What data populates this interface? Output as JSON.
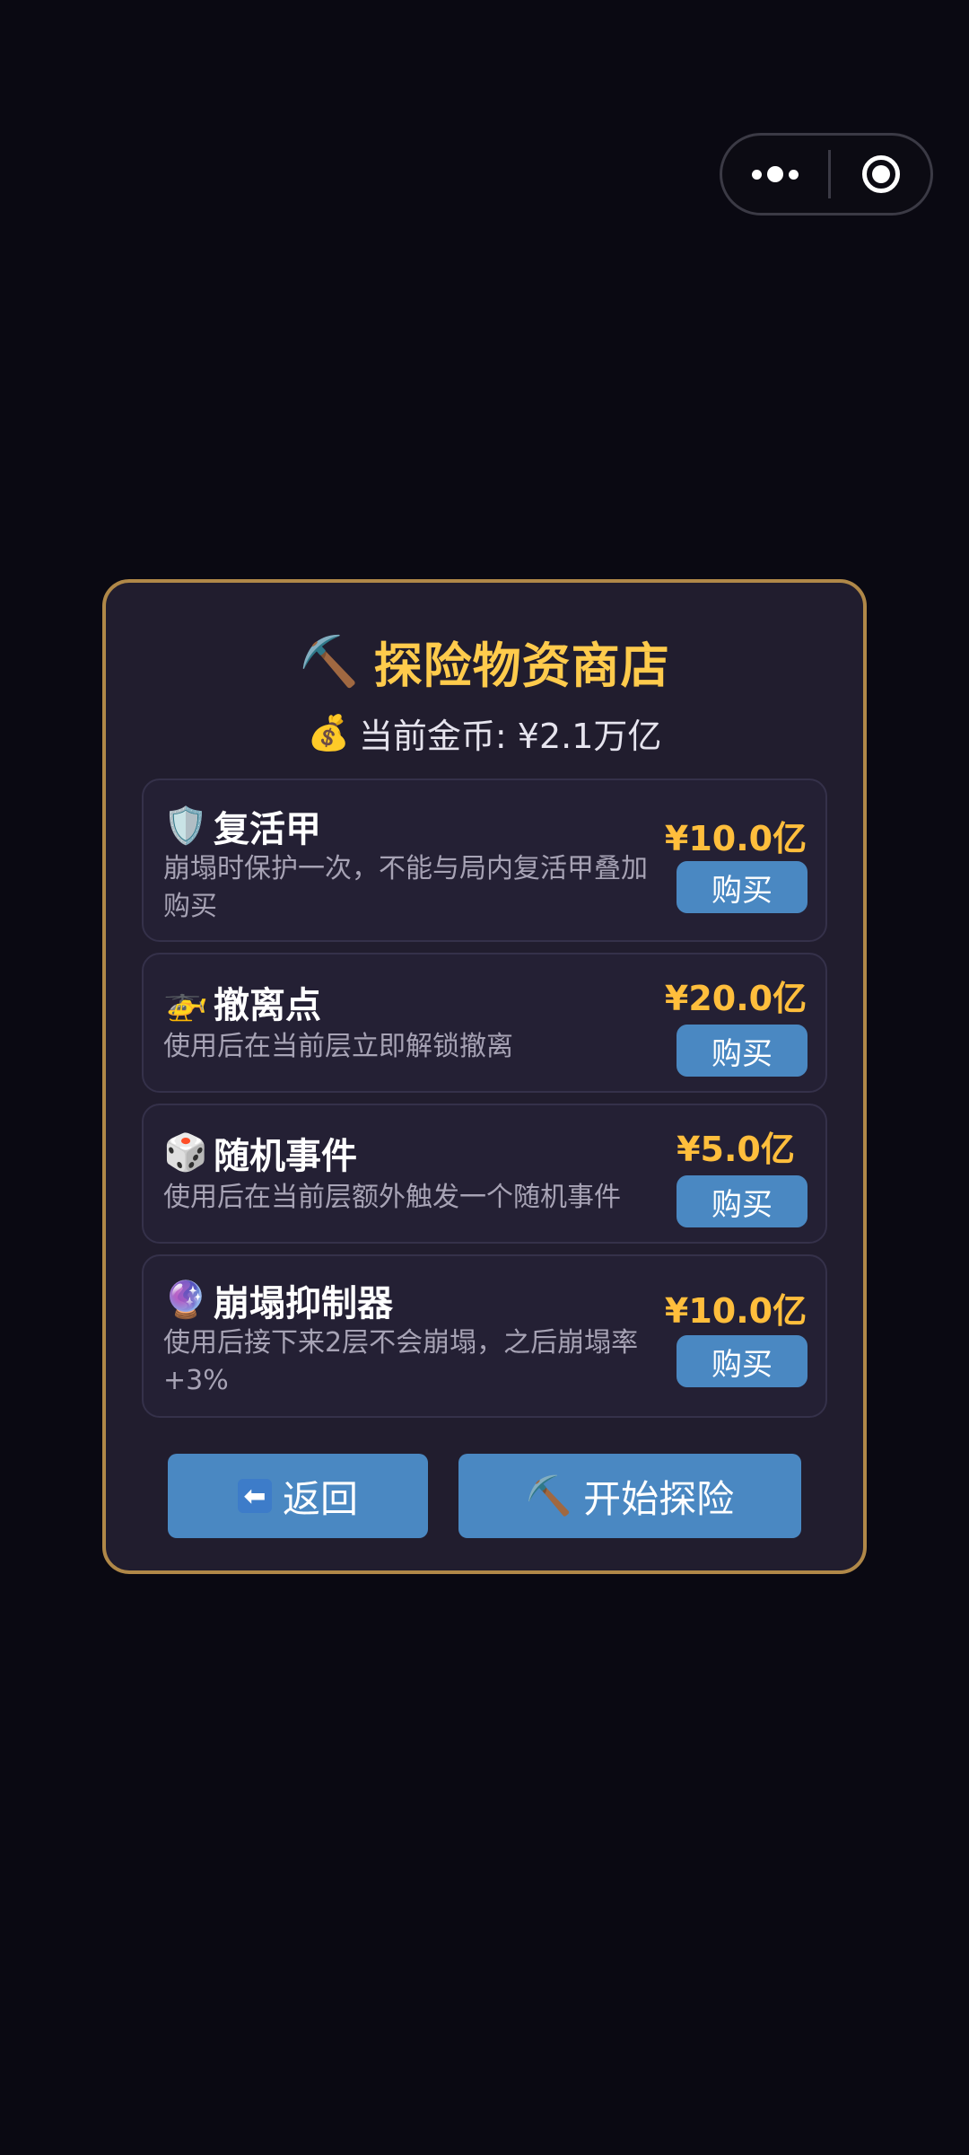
{
  "capsule": {
    "more_icon": "more-dots-icon",
    "close_icon": "target-close-icon"
  },
  "shop": {
    "title_icon": "⛏️",
    "title": "探险物资商店",
    "coins_icon": "💰",
    "coins_text": "当前金币: ¥2.1万亿"
  },
  "items": [
    {
      "icon": "🛡️",
      "name": "复活甲",
      "desc": "崩塌时保护一次，不能与局内复活甲叠加购买",
      "price": "¥10.0亿",
      "buy": "购买"
    },
    {
      "icon": "🚁",
      "name": "撤离点",
      "desc": "使用后在当前层立即解锁撤离",
      "price": "¥20.0亿",
      "buy": "购买"
    },
    {
      "icon": "🎲",
      "name": "随机事件",
      "desc": "使用后在当前层额外触发一个随机事件",
      "price": "¥5.0亿",
      "buy": "购买"
    },
    {
      "icon": "🔮",
      "name": "崩塌抑制器",
      "desc": "使用后接下来2层不会崩塌，之后崩塌率+3%",
      "price": "¥10.0亿",
      "buy": "购买"
    }
  ],
  "footer": {
    "back_icon": "⬅",
    "back_label": "返回",
    "start_icon": "⛏️",
    "start_label": "开始探险"
  },
  "colors": {
    "background": "#0a0912",
    "panel": "#211d2e",
    "border_gold": "#b08848",
    "title": "#ffcb4c",
    "price": "#ffbe3c",
    "button": "#4a88c2"
  }
}
